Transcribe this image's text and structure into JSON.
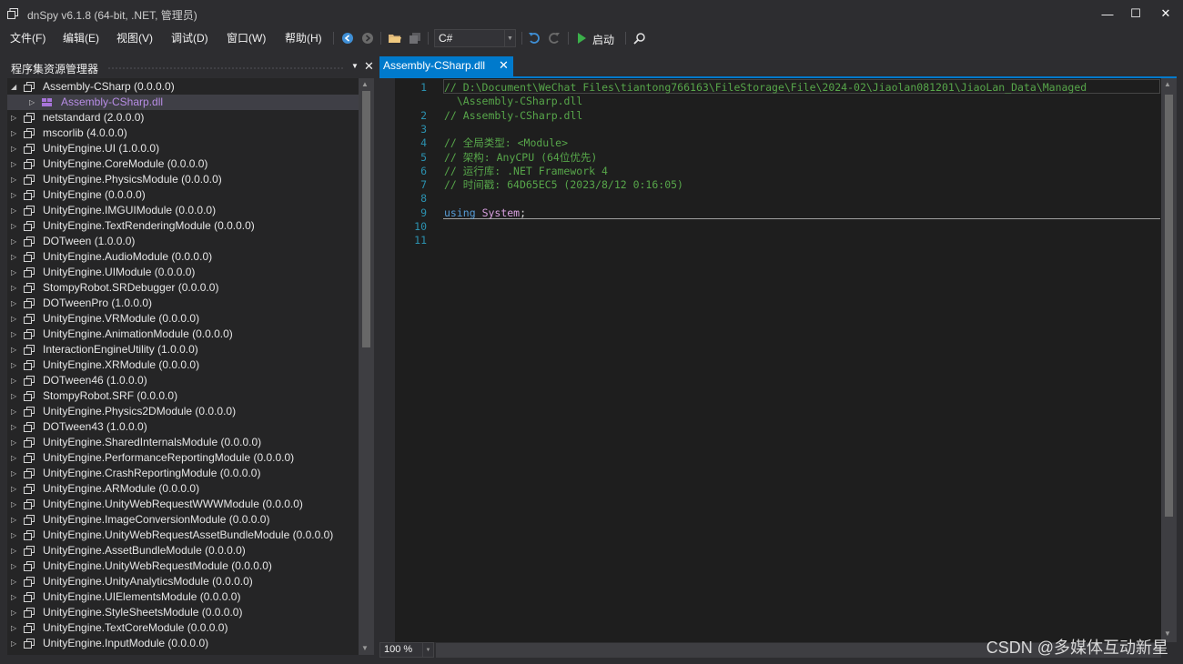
{
  "window": {
    "title": "dnSpy v6.1.8 (64-bit, .NET, 管理员)",
    "minimize": "—",
    "maximize": "☐",
    "close": "✕"
  },
  "menu": [
    "文件(F)",
    "编辑(E)",
    "视图(V)",
    "调试(D)",
    "窗口(W)",
    "帮助(H)"
  ],
  "toolbar": {
    "language": "C#",
    "start_label": "启动"
  },
  "explorer": {
    "title": "程序集资源管理器",
    "items": [
      {
        "name": "Assembly-CSharp",
        "version": "(0.0.0.0)",
        "expanded": true
      },
      {
        "name": "Assembly-CSharp.dll",
        "version": "",
        "child": true
      },
      {
        "name": "netstandard",
        "version": "(2.0.0.0)"
      },
      {
        "name": "mscorlib",
        "version": "(4.0.0.0)"
      },
      {
        "name": "UnityEngine.UI",
        "version": "(1.0.0.0)"
      },
      {
        "name": "UnityEngine.CoreModule",
        "version": "(0.0.0.0)"
      },
      {
        "name": "UnityEngine.PhysicsModule",
        "version": "(0.0.0.0)"
      },
      {
        "name": "UnityEngine",
        "version": "(0.0.0.0)"
      },
      {
        "name": "UnityEngine.IMGUIModule",
        "version": "(0.0.0.0)"
      },
      {
        "name": "UnityEngine.TextRenderingModule",
        "version": "(0.0.0.0)"
      },
      {
        "name": "DOTween",
        "version": "(1.0.0.0)"
      },
      {
        "name": "UnityEngine.AudioModule",
        "version": "(0.0.0.0)"
      },
      {
        "name": "UnityEngine.UIModule",
        "version": "(0.0.0.0)"
      },
      {
        "name": "StompyRobot.SRDebugger",
        "version": "(0.0.0.0)"
      },
      {
        "name": "DOTweenPro",
        "version": "(1.0.0.0)"
      },
      {
        "name": "UnityEngine.VRModule",
        "version": "(0.0.0.0)"
      },
      {
        "name": "UnityEngine.AnimationModule",
        "version": "(0.0.0.0)"
      },
      {
        "name": "InteractionEngineUtility",
        "version": "(1.0.0.0)"
      },
      {
        "name": "UnityEngine.XRModule",
        "version": "(0.0.0.0)"
      },
      {
        "name": "DOTween46",
        "version": "(1.0.0.0)"
      },
      {
        "name": "StompyRobot.SRF",
        "version": "(0.0.0.0)"
      },
      {
        "name": "UnityEngine.Physics2DModule",
        "version": "(0.0.0.0)"
      },
      {
        "name": "DOTween43",
        "version": "(1.0.0.0)"
      },
      {
        "name": "UnityEngine.SharedInternalsModule",
        "version": "(0.0.0.0)"
      },
      {
        "name": "UnityEngine.PerformanceReportingModule",
        "version": "(0.0.0.0)"
      },
      {
        "name": "UnityEngine.CrashReportingModule",
        "version": "(0.0.0.0)"
      },
      {
        "name": "UnityEngine.ARModule",
        "version": "(0.0.0.0)"
      },
      {
        "name": "UnityEngine.UnityWebRequestWWWModule",
        "version": "(0.0.0.0)"
      },
      {
        "name": "UnityEngine.ImageConversionModule",
        "version": "(0.0.0.0)"
      },
      {
        "name": "UnityEngine.UnityWebRequestAssetBundleModule",
        "version": "(0.0.0.0)"
      },
      {
        "name": "UnityEngine.AssetBundleModule",
        "version": "(0.0.0.0)"
      },
      {
        "name": "UnityEngine.UnityWebRequestModule",
        "version": "(0.0.0.0)"
      },
      {
        "name": "UnityEngine.UnityAnalyticsModule",
        "version": "(0.0.0.0)"
      },
      {
        "name": "UnityEngine.UIElementsModule",
        "version": "(0.0.0.0)"
      },
      {
        "name": "UnityEngine.StyleSheetsModule",
        "version": "(0.0.0.0)"
      },
      {
        "name": "UnityEngine.TextCoreModule",
        "version": "(0.0.0.0)"
      },
      {
        "name": "UnityEngine.InputModule",
        "version": "(0.0.0.0)"
      }
    ]
  },
  "editor": {
    "tab_label": "Assembly-CSharp.dll",
    "zoom": "100 %",
    "lines": [
      {
        "n": "1",
        "parts": [
          {
            "t": "// D:\\Document\\WeChat Files\\tiantong766163\\FileStorage\\File\\2024-02\\Jiaolan081201\\JiaoLan_Data\\Managed",
            "c": "cmt"
          }
        ]
      },
      {
        "n": "",
        "parts": [
          {
            "t": "  \\Assembly-CSharp.dll",
            "c": "cmt"
          }
        ]
      },
      {
        "n": "2",
        "parts": [
          {
            "t": "// Assembly-CSharp.dll",
            "c": "cmt"
          }
        ]
      },
      {
        "n": "3",
        "parts": []
      },
      {
        "n": "4",
        "parts": [
          {
            "t": "// 全局类型: <Module>",
            "c": "cmt"
          }
        ]
      },
      {
        "n": "5",
        "parts": [
          {
            "t": "// 架构: AnyCPU (64位优先)",
            "c": "cmt"
          }
        ]
      },
      {
        "n": "6",
        "parts": [
          {
            "t": "// 运行库: .NET Framework 4",
            "c": "cmt"
          }
        ]
      },
      {
        "n": "7",
        "parts": [
          {
            "t": "// 时间戳: 64D65EC5 (2023/8/12 0:16:05)",
            "c": "cmt"
          }
        ]
      },
      {
        "n": "8",
        "parts": []
      },
      {
        "n": "9",
        "parts": [
          {
            "t": "using",
            "c": "kw"
          },
          {
            "t": " ",
            "c": "pl"
          },
          {
            "t": "System",
            "c": "ns"
          },
          {
            "t": ";",
            "c": "pl"
          }
        ]
      },
      {
        "n": "10",
        "parts": []
      },
      {
        "n": "11",
        "parts": []
      }
    ]
  },
  "watermark": "CSDN @多媒体互动新星"
}
